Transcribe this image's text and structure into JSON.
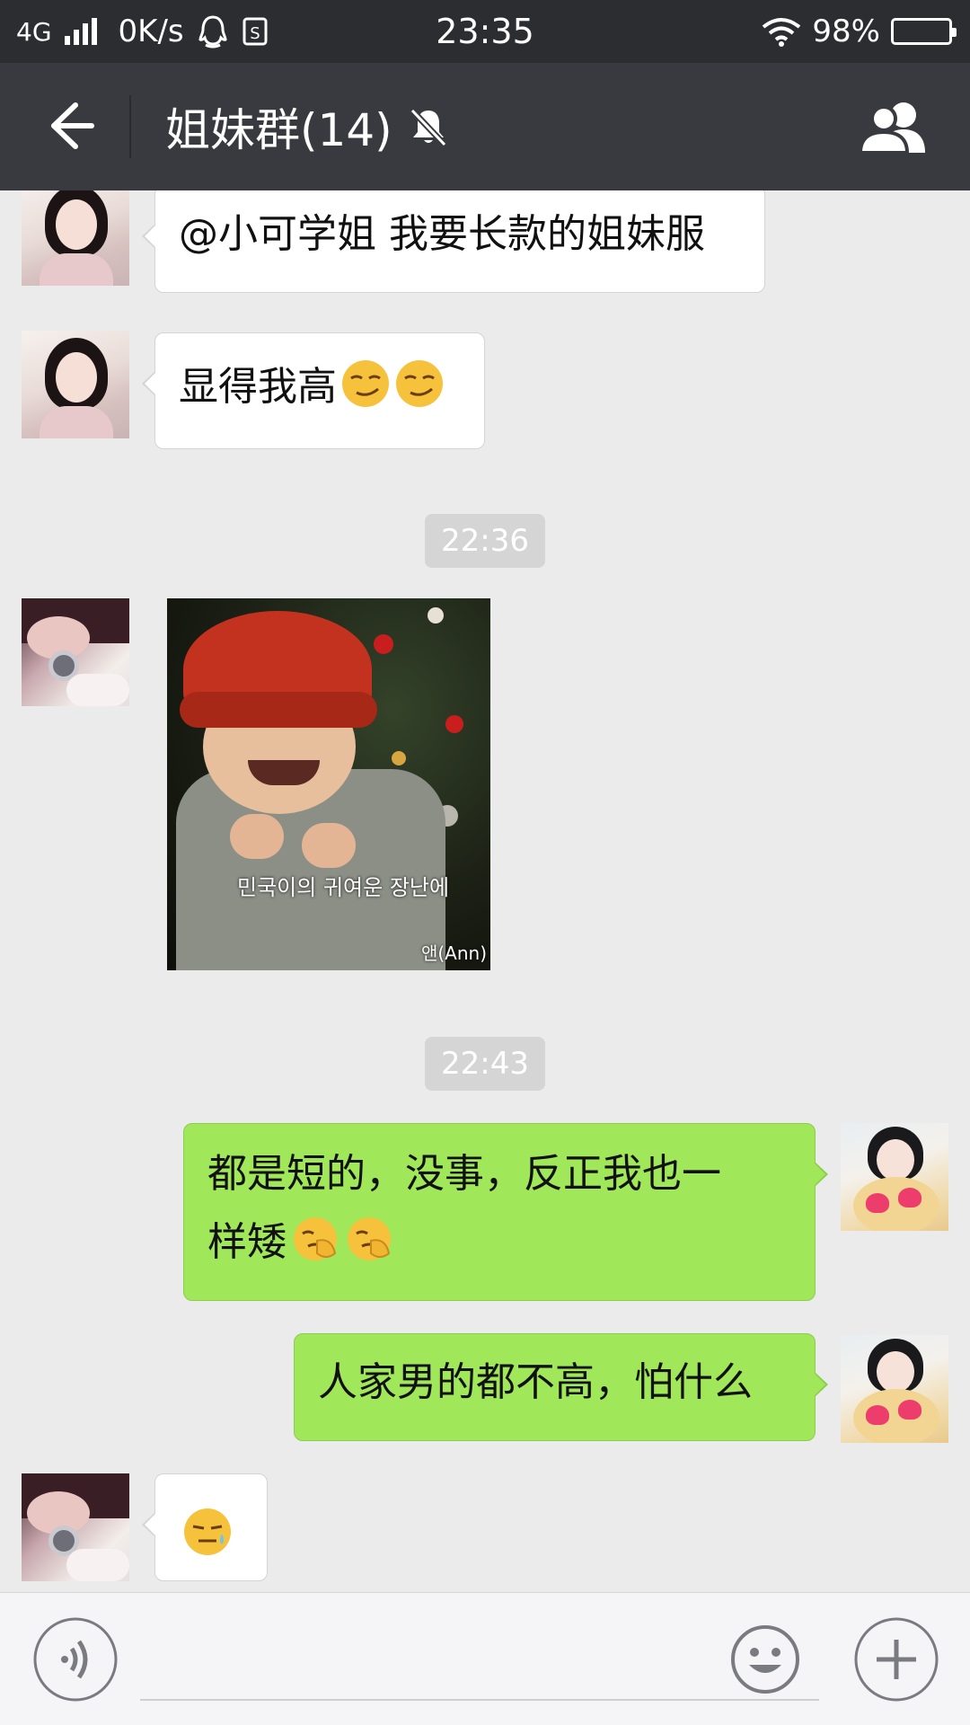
{
  "status_bar": {
    "network": "4G",
    "speed": "0K/s",
    "time": "23:35",
    "battery": "98%",
    "battery_level": 0.98
  },
  "header": {
    "title": "姐妹群(14)",
    "muted": true
  },
  "messages": [
    {
      "side": "left",
      "text": "@小可学姐 我要长款的姐妹服"
    },
    {
      "side": "left",
      "text": "显得我高",
      "emoji": [
        "smirk-emoji",
        "smirk-emoji"
      ]
    },
    {
      "type": "timestamp",
      "text": "22:36"
    },
    {
      "side": "left",
      "type": "image",
      "caption": "민국이의 귀여운 장난에",
      "watermark": "앤(Ann)"
    },
    {
      "type": "timestamp",
      "text": "22:43"
    },
    {
      "side": "right",
      "line1": "都是短的，没事，反正我也一",
      "line2": "样矮",
      "emoji": [
        "facepalm-emoji",
        "facepalm-emoji"
      ]
    },
    {
      "side": "right",
      "text": "人家男的都不高，怕什么"
    },
    {
      "side": "left",
      "text": "",
      "emoji": [
        "sweat-emoji"
      ]
    }
  ],
  "colors": {
    "status_bg": "#2c2d31",
    "nav_bg": "#393a3f",
    "chat_bg": "#ebebeb",
    "bubble_green": "#a0e75a"
  }
}
